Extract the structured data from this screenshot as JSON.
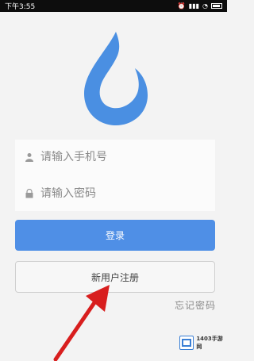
{
  "status_bar": {
    "time": "下午3:55",
    "icons": [
      "signal-icon",
      "wifi-icon",
      "battery-icon"
    ]
  },
  "login_form": {
    "phone_placeholder": "请输入手机号",
    "password_placeholder": "请输入密码",
    "login_label": "登录",
    "register_label": "新用户注册",
    "forgot_label": "忘记密码"
  },
  "watermark": {
    "text": "1403手游网"
  },
  "colors": {
    "logo_blue": "#4a8fe2",
    "button_blue": "#4f8fe6",
    "arrow_red": "#d81e1e",
    "background": "#f3f3f3"
  }
}
